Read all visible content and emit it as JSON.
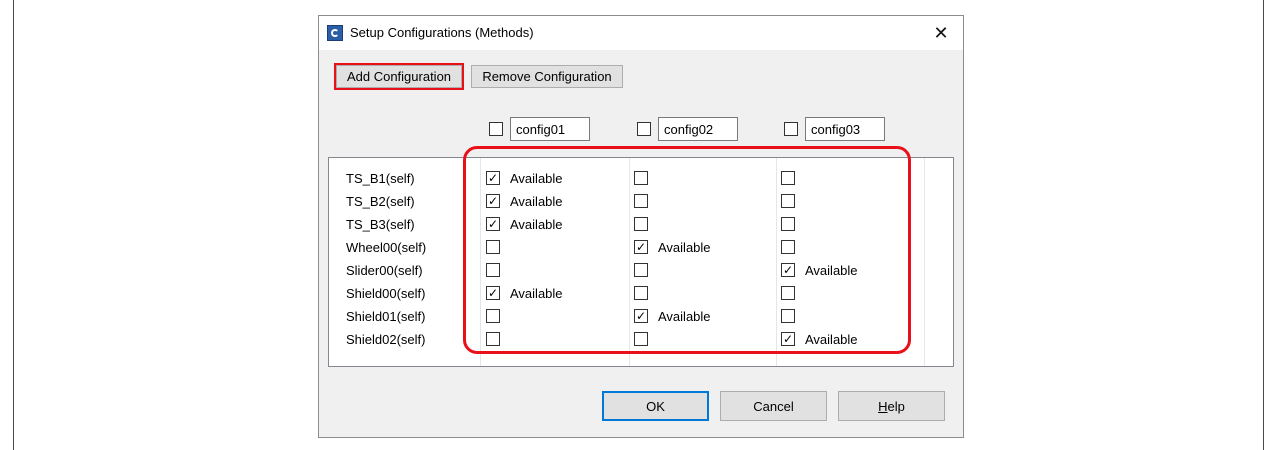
{
  "dialog": {
    "title": "Setup Configurations (Methods)",
    "close_glyph": "✕"
  },
  "toolbar": {
    "add_label": "Add Configuration",
    "remove_label": "Remove Configuration"
  },
  "configs": [
    {
      "name": "config01",
      "checked": false
    },
    {
      "name": "config02",
      "checked": false
    },
    {
      "name": "config03",
      "checked": false
    }
  ],
  "rows": [
    {
      "label": "TS_B1(self)",
      "cells": [
        {
          "checked": true,
          "text": "Available"
        },
        {
          "checked": false,
          "text": ""
        },
        {
          "checked": false,
          "text": ""
        }
      ]
    },
    {
      "label": "TS_B2(self)",
      "cells": [
        {
          "checked": true,
          "text": "Available"
        },
        {
          "checked": false,
          "text": ""
        },
        {
          "checked": false,
          "text": ""
        }
      ]
    },
    {
      "label": "TS_B3(self)",
      "cells": [
        {
          "checked": true,
          "text": "Available"
        },
        {
          "checked": false,
          "text": ""
        },
        {
          "checked": false,
          "text": ""
        }
      ]
    },
    {
      "label": "Wheel00(self)",
      "cells": [
        {
          "checked": false,
          "text": ""
        },
        {
          "checked": true,
          "text": "Available"
        },
        {
          "checked": false,
          "text": ""
        }
      ]
    },
    {
      "label": "Slider00(self)",
      "cells": [
        {
          "checked": false,
          "text": ""
        },
        {
          "checked": false,
          "text": ""
        },
        {
          "checked": true,
          "text": "Available"
        }
      ]
    },
    {
      "label": "Shield00(self)",
      "cells": [
        {
          "checked": true,
          "text": "Available"
        },
        {
          "checked": false,
          "text": ""
        },
        {
          "checked": false,
          "text": ""
        }
      ]
    },
    {
      "label": "Shield01(self)",
      "cells": [
        {
          "checked": false,
          "text": ""
        },
        {
          "checked": true,
          "text": "Available"
        },
        {
          "checked": false,
          "text": ""
        }
      ]
    },
    {
      "label": "Shield02(self)",
      "cells": [
        {
          "checked": false,
          "text": ""
        },
        {
          "checked": false,
          "text": ""
        },
        {
          "checked": true,
          "text": "Available"
        }
      ]
    }
  ],
  "footer": {
    "ok_label": "OK",
    "cancel_label": "Cancel",
    "help_label": "Help"
  },
  "check_glyph": "✓",
  "colors": {
    "highlight": "#e8111a",
    "ok_border": "#0078d7"
  },
  "icons": {
    "title": "app-icon",
    "close": "close-icon"
  }
}
